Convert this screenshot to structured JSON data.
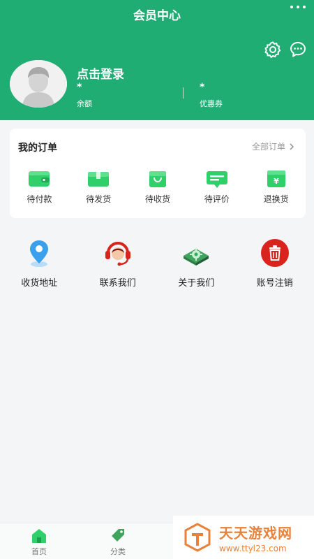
{
  "header": {
    "title": "会员中心",
    "login_text": "点击登录",
    "balance": {
      "value": "*",
      "label": "余额"
    },
    "coupon": {
      "value": "*",
      "label": "优惠券"
    }
  },
  "orders": {
    "title": "我的订单",
    "all_label": "全部订单",
    "items": [
      {
        "label": "待付款",
        "icon": "wallet-icon"
      },
      {
        "label": "待发货",
        "icon": "package-icon"
      },
      {
        "label": "待收货",
        "icon": "shopping-bag-icon"
      },
      {
        "label": "待评价",
        "icon": "comment-card-icon"
      },
      {
        "label": "退换货",
        "icon": "yen-refund-icon"
      }
    ]
  },
  "services": [
    {
      "label": "收货地址",
      "icon": "location-pin-icon"
    },
    {
      "label": "联系我们",
      "icon": "customer-service-icon"
    },
    {
      "label": "关于我们",
      "icon": "gear-board-icon"
    },
    {
      "label": "账号注销",
      "icon": "trash-icon"
    }
  ],
  "tabbar": {
    "items": [
      {
        "label": "首页",
        "icon": "home-icon"
      },
      {
        "label": "分类",
        "icon": "tag-icon"
      }
    ]
  },
  "watermark": {
    "name": "天天游戏网",
    "url": "www.ttyl23.com"
  },
  "colors": {
    "brand": "#1fad73",
    "icon_green": "#2fcf6a",
    "danger": "#d9241d",
    "watermark": "#e8823b"
  }
}
